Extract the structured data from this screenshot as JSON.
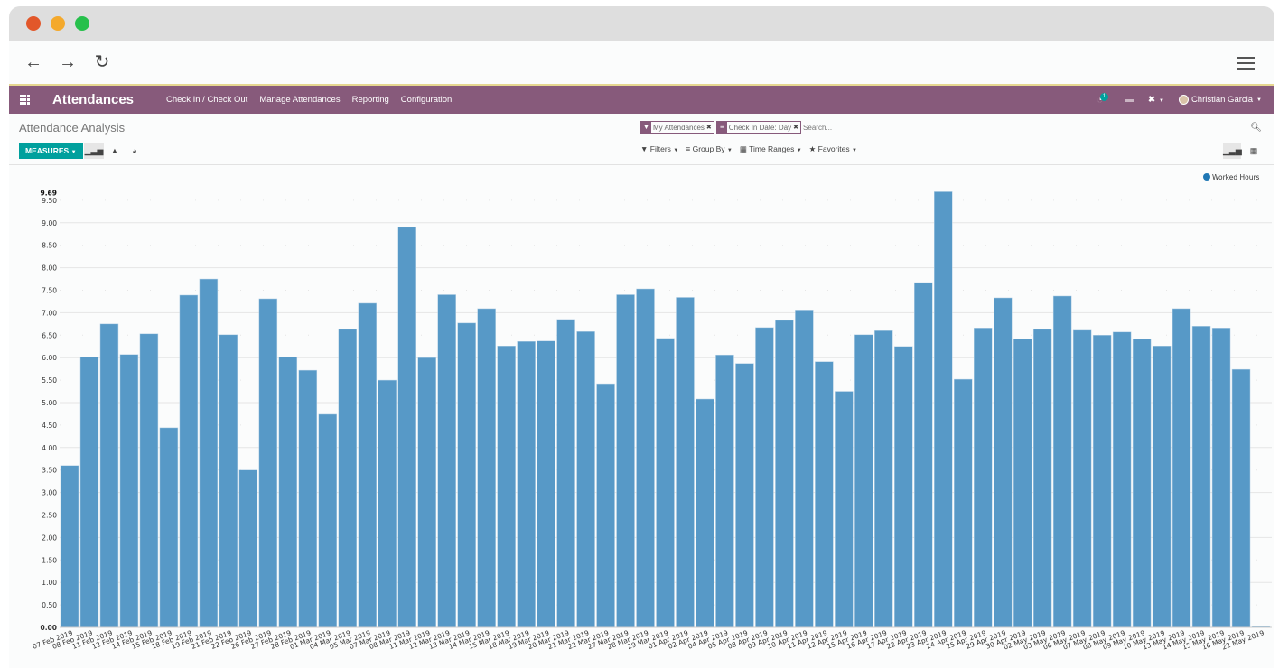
{
  "browser": {
    "traffic_lights": [
      "#e2572a",
      "#f4a92c",
      "#27c04c"
    ],
    "back_icon": "←",
    "forward_icon": "→",
    "reload_icon": "↻"
  },
  "app": {
    "title": "Attendances",
    "menu": [
      "Check In / Check Out",
      "Manage Attendances",
      "Reporting",
      "Configuration"
    ],
    "activity_badge": "1",
    "user_name": "Christian Garcia",
    "brand_color": "#875a7b",
    "accent_color": "#00a09d"
  },
  "control_panel": {
    "title": "Attendance Analysis",
    "measures_label": "MEASURES",
    "search_facets": [
      {
        "icon": "filter-icon",
        "label": "My Attendances"
      },
      {
        "icon": "group-by-icon",
        "label": "Check In Date: Day"
      }
    ],
    "search_placeholder": "Search...",
    "filters_label": "Filters",
    "group_by_label": "Group By",
    "time_ranges_label": "Time Ranges",
    "favorites_label": "Favorites"
  },
  "chart_data": {
    "type": "bar",
    "title": "",
    "xlabel": "",
    "ylabel": "",
    "legend": [
      {
        "name": "Worked Hours",
        "color": "#1f77b4"
      }
    ],
    "legend_position": "top-right",
    "bar_color": "#5799c7",
    "ylim": [
      0,
      9.69
    ],
    "yticks": [
      "0.00",
      "0.50",
      "1.00",
      "1.50",
      "2.00",
      "2.50",
      "3.00",
      "3.50",
      "4.00",
      "4.50",
      "5.00",
      "5.50",
      "6.00",
      "6.50",
      "7.00",
      "7.50",
      "8.00",
      "8.50",
      "9.00",
      "9.50"
    ],
    "ymax_label": "9.69",
    "grid": true,
    "categories": [
      "07 Feb 2019",
      "08 Feb 2019",
      "11 Feb 2019",
      "12 Feb 2019",
      "14 Feb 2019",
      "15 Feb 2019",
      "18 Feb 2019",
      "19 Feb 2019",
      "21 Feb 2019",
      "22 Feb 2019",
      "26 Feb 2019",
      "27 Feb 2019",
      "28 Feb 2019",
      "01 Mar 2019",
      "04 Mar 2019",
      "05 Mar 2019",
      "07 Mar 2019",
      "08 Mar 2019",
      "11 Mar 2019",
      "12 Mar 2019",
      "13 Mar 2019",
      "14 Mar 2019",
      "15 Mar 2019",
      "18 Mar 2019",
      "19 Mar 2019",
      "20 Mar 2019",
      "21 Mar 2019",
      "22 Mar 2019",
      "27 Mar 2019",
      "28 Mar 2019",
      "29 Mar 2019",
      "01 Apr 2019",
      "02 Apr 2019",
      "04 Apr 2019",
      "05 Apr 2019",
      "08 Apr 2019",
      "09 Apr 2019",
      "10 Apr 2019",
      "11 Apr 2019",
      "12 Apr 2019",
      "15 Apr 2019",
      "16 Apr 2019",
      "17 Apr 2019",
      "22 Apr 2019",
      "23 Apr 2019",
      "24 Apr 2019",
      "25 Apr 2019",
      "29 Apr 2019",
      "30 Apr 2019",
      "02 May 2019",
      "03 May 2019",
      "06 May 2019",
      "07 May 2019",
      "08 May 2019",
      "09 May 2019",
      "10 May 2019",
      "13 May 2019",
      "14 May 2019",
      "15 May 2019",
      "16 May 2019",
      "22 May 2019"
    ],
    "series": [
      {
        "name": "Worked Hours",
        "values": [
          3.6,
          6.01,
          6.75,
          6.07,
          6.53,
          4.44,
          7.39,
          7.75,
          6.51,
          3.5,
          7.31,
          6.01,
          5.72,
          4.74,
          6.63,
          7.21,
          5.5,
          8.9,
          6.0,
          7.4,
          6.77,
          7.09,
          6.26,
          6.36,
          6.37,
          6.85,
          6.58,
          5.42,
          7.4,
          7.53,
          6.43,
          7.34,
          5.08,
          6.06,
          5.87,
          6.67,
          6.83,
          7.06,
          5.91,
          5.25,
          6.51,
          6.6,
          6.25,
          7.67,
          9.69,
          5.52,
          6.66,
          7.33,
          6.42,
          6.63,
          7.37,
          6.61,
          6.5,
          6.57,
          6.41,
          6.26,
          7.09,
          6.7,
          6.66,
          5.74,
          0.02
        ]
      }
    ]
  }
}
